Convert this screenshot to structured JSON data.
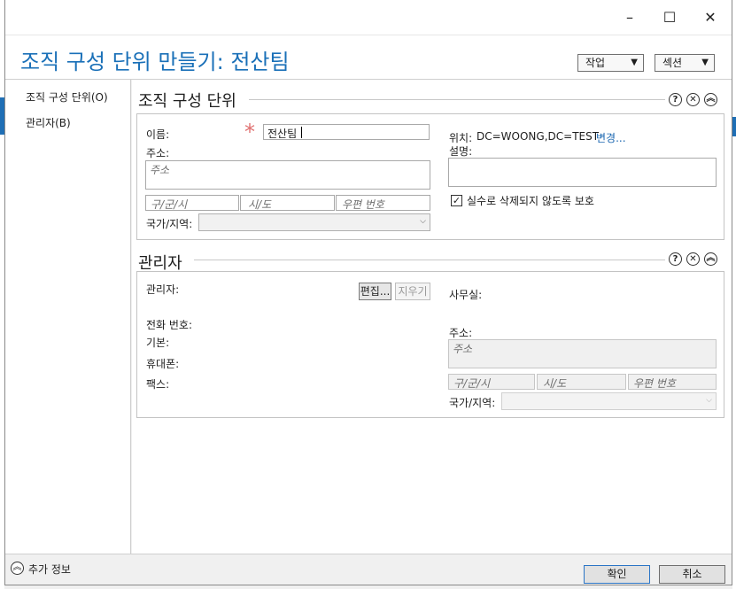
{
  "window": {
    "title": "조직 구성 단위 만들기: 전산팀",
    "controls": {
      "minimize": "–",
      "maximize": "☐",
      "close": "✕"
    }
  },
  "header": {
    "tasks_label": "작업",
    "sections_label": "섹션",
    "dropdown_arrow": "▼"
  },
  "nav": {
    "items": [
      {
        "label": "조직 구성 단위(O)"
      },
      {
        "label": "관리자(B)"
      }
    ]
  },
  "ou_section": {
    "title": "조직 구성 단위",
    "help_icon": "?",
    "close_icon": "✕",
    "collapse_icon": "︽",
    "name_label": "이름:",
    "required_marker": "*",
    "name_value": "전산팀",
    "address_label": "주소:",
    "address_placeholder": "주소",
    "city_placeholder": "구/군/시",
    "state_placeholder": "시/도",
    "zip_placeholder": "우편 번호",
    "country_label": "국가/지역:",
    "country_value": "",
    "location_label": "위치:",
    "location_value": "DC=WOONG,DC=TEST",
    "change_link": "변경...",
    "description_label": "설명:",
    "description_value": "",
    "protect_label": "실수로 삭제되지 않도록 보호",
    "protect_checked": true
  },
  "manager_section": {
    "title": "관리자",
    "help_icon": "?",
    "close_icon": "✕",
    "collapse_icon": "︽",
    "manager_label": "관리자:",
    "edit_button": "편집...",
    "clear_button": "지우기",
    "office_label": "사무실:",
    "phone_label": "전화 번호:",
    "main_label": "기본:",
    "mobile_label": "휴대폰:",
    "fax_label": "팩스:",
    "address_label": "주소:",
    "address_placeholder": "주소",
    "city_placeholder": "구/군/시",
    "state_placeholder": "시/도",
    "zip_placeholder": "우편 번호",
    "country_label": "국가/지역:",
    "country_value": ""
  },
  "footer": {
    "more_info_icon": "︽",
    "more_info_label": "추가 정보",
    "ok_label": "확인",
    "cancel_label": "취소"
  },
  "colors": {
    "accent": "#1a70b8",
    "required": "#e07070",
    "link": "#1a66b0"
  }
}
